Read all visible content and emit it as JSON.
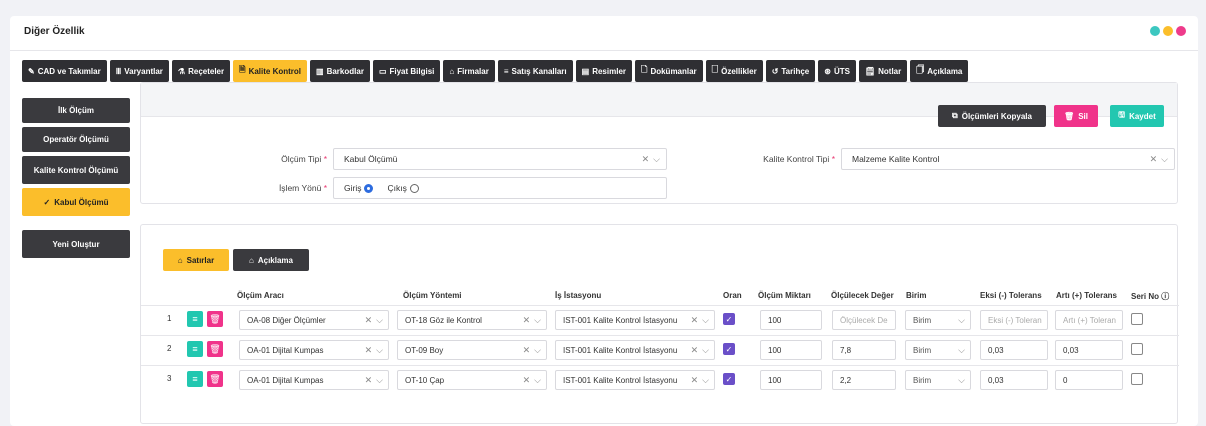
{
  "header": {
    "title": "Diğer Özellik",
    "dots": [
      "#3cc7c0",
      "#fbbe2b",
      "#ee3b8b"
    ]
  },
  "tabs": [
    {
      "icon": "✎",
      "label": "CAD ve Takımlar"
    },
    {
      "icon": "Ⅲ",
      "label": "Varyantlar"
    },
    {
      "icon": "⚗",
      "label": "Reçeteler"
    },
    {
      "icon": "🗎",
      "label": "Kalite Kontrol"
    },
    {
      "icon": "▥",
      "label": "Barkodlar"
    },
    {
      "icon": "▭",
      "label": "Fiyat Bilgisi"
    },
    {
      "icon": "⌂",
      "label": "Firmalar"
    },
    {
      "icon": "≡",
      "label": "Satış Kanalları"
    },
    {
      "icon": "▤",
      "label": "Resimler"
    },
    {
      "icon": "🗋",
      "label": "Dokümanlar"
    },
    {
      "icon": "🗌",
      "label": "Özellikler"
    },
    {
      "icon": "↺",
      "label": "Tarihçe"
    },
    {
      "icon": "⊛",
      "label": "ÜTS"
    },
    {
      "icon": "🗒",
      "label": "Notlar"
    },
    {
      "icon": "🗍",
      "label": "Açıklama"
    }
  ],
  "active_tab": "Kalite Kontrol",
  "sidebar": {
    "items": [
      "İlk Ölçüm",
      "Operatör Ölçümü",
      "Kalite Kontrol Ölçümü",
      "Kabul Ölçümü"
    ],
    "active": "Kabul Ölçümü",
    "new_button": "Yeni Oluştur"
  },
  "actions": {
    "copy": "Ölçümleri Kopyala",
    "delete": "Sil",
    "save": "Kaydet"
  },
  "form": {
    "measure_type_label": "Ölçüm Tipi",
    "measure_type_value": "Kabul Ölçümü",
    "qc_type_label": "Kalite Kontrol Tipi",
    "qc_type_value": "Malzeme Kalite Kontrol",
    "direction_label": "İşlem Yönü",
    "direction_in": "Giriş",
    "direction_out": "Çıkış",
    "direction_selected": "Giriş"
  },
  "subtabs": {
    "rows": "Satırlar",
    "desc": "Açıklama"
  },
  "table": {
    "headers": [
      "Ölçüm Aracı",
      "Ölçüm Yöntemi",
      "İş İstasyonu",
      "Oran",
      "Ölçüm Miktarı",
      "Ölçülecek Değer",
      "Birim",
      "Eksi (-) Tolerans",
      "Artı (+) Tolerans",
      "Seri No ⓘ"
    ],
    "rows": [
      {
        "no": "1",
        "tool": "OA-08 Diğer Ölçümler",
        "method": "OT-18 Göz ile Kontrol",
        "station": "IST-001 Kalite Kontrol İstasyonu",
        "oran": true,
        "qty": "100",
        "value": "",
        "value_ph": "Ölçülecek De",
        "unit": "Birim",
        "minus": "",
        "minus_ph": "Eksi (-) Toleran",
        "plus": "",
        "plus_ph": "Artı (+) Toleran",
        "serial": false
      },
      {
        "no": "2",
        "tool": "OA-01 Dijital Kumpas",
        "method": "OT-09 Boy",
        "station": "IST-001 Kalite Kontrol İstasyonu",
        "oran": true,
        "qty": "100",
        "value": "7,8",
        "value_ph": "",
        "unit": "Birim",
        "minus": "0,03",
        "minus_ph": "",
        "plus": "0,03",
        "plus_ph": "",
        "serial": false
      },
      {
        "no": "3",
        "tool": "OA-01 Dijital Kumpas",
        "method": "OT-10 Çap",
        "station": "IST-001 Kalite Kontrol İstasyonu",
        "oran": true,
        "qty": "100",
        "value": "2,2",
        "value_ph": "",
        "unit": "Birim",
        "minus": "0,03",
        "minus_ph": "",
        "plus": "0",
        "plus_ph": "",
        "serial": false
      }
    ]
  }
}
